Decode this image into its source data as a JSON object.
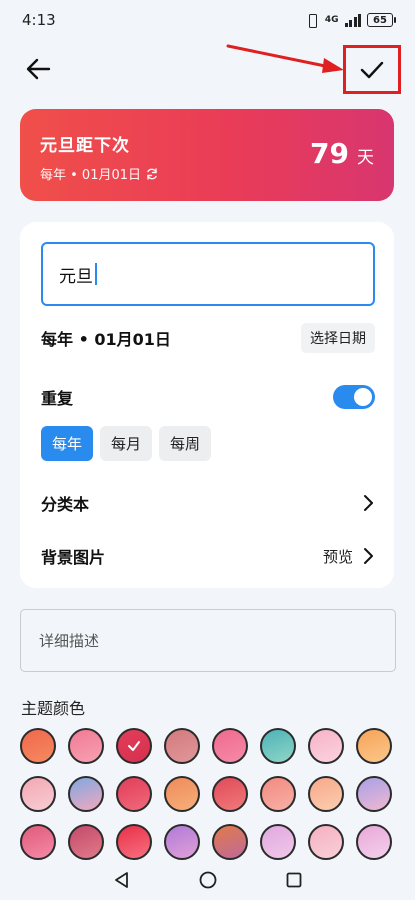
{
  "status_bar": {
    "time": "4:13",
    "network": "4G",
    "battery": "65"
  },
  "banner": {
    "title": "元旦距下次",
    "subtitle": "每年 • 01月01日",
    "days": "79",
    "unit": "天"
  },
  "form": {
    "name_value": "元旦",
    "date_text": "每年 • 01月01日",
    "pick_date_label": "选择日期",
    "repeat_label": "重复",
    "repeat_enabled": true,
    "repeat_options": [
      "每年",
      "每月",
      "每周"
    ],
    "repeat_selected": "每年",
    "category_label": "分类本",
    "background_label": "背景图片",
    "background_action": "预览"
  },
  "description": {
    "placeholder": "详细描述"
  },
  "theme": {
    "title": "主题颜色",
    "selected_index": 2,
    "colors": [
      [
        "#f0684d",
        "#f58a5f"
      ],
      [
        "#f07a93",
        "#f7a1b3"
      ],
      [
        "#e23d5a",
        "#d6304f"
      ],
      [
        "#d37a7e",
        "#e0979a"
      ],
      [
        "#f06a8c",
        "#f58aa8"
      ],
      [
        "#4db2b8",
        "#8fd6c6"
      ],
      [
        "#f7b2c8",
        "#fbd3e0"
      ],
      [
        "#f7a35a",
        "#fbc78a"
      ],
      [
        "#f3a8b3",
        "#f8ccd4"
      ],
      [
        "#7fa9e0",
        "#f2a8c0"
      ],
      [
        "#e23d5a",
        "#f06a7a"
      ],
      [
        "#f08a5a",
        "#f5b07a"
      ],
      [
        "#e04a5a",
        "#f07a7a"
      ],
      [
        "#f28a80",
        "#f8b0a6"
      ],
      [
        "#f7a88a",
        "#fbcdb0"
      ],
      [
        "#a8a0e8",
        "#f0b8d0"
      ],
      [
        "#e05a7a",
        "#f58aa8"
      ],
      [
        "#c44a6a",
        "#e07a8a"
      ],
      [
        "#e83048",
        "#f87080"
      ],
      [
        "#b07ad8",
        "#e0a0d8"
      ],
      [
        "#e07a4a",
        "#c06a9a"
      ],
      [
        "#e0a8e0",
        "#f0c8e8"
      ],
      [
        "#f5b0c0",
        "#f8d0d8"
      ],
      [
        "#e8a8d8",
        "#f4d0ec"
      ]
    ]
  }
}
